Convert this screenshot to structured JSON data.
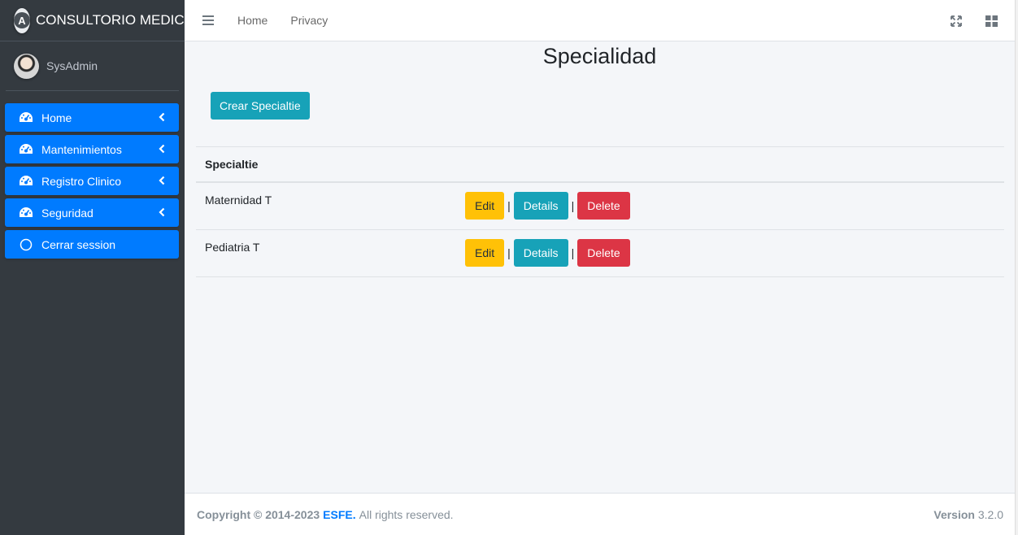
{
  "brand": {
    "name": "CONSULTORIO MEDICO",
    "logo_letter": "A"
  },
  "user": {
    "name": "SysAdmin"
  },
  "sidebar": {
    "items": [
      {
        "label": "Home",
        "icon": "tachometer-icon",
        "has_arrow": true
      },
      {
        "label": "Mantenimientos",
        "icon": "tachometer-icon",
        "has_arrow": true
      },
      {
        "label": "Registro Clinico",
        "icon": "tachometer-icon",
        "has_arrow": true
      },
      {
        "label": "Seguridad",
        "icon": "tachometer-icon",
        "has_arrow": true
      },
      {
        "label": "Cerrar session",
        "icon": "circle-icon",
        "has_arrow": false
      }
    ]
  },
  "header": {
    "nav": [
      {
        "label": "Home"
      },
      {
        "label": "Privacy"
      }
    ],
    "icons": [
      "fullscreen-icon",
      "grid-icon"
    ]
  },
  "main": {
    "title": "Specialidad",
    "create_label": "Crear Specialtie",
    "table": {
      "column_header": "Specialtie",
      "rows": [
        {
          "name": "Maternidad T"
        },
        {
          "name": "Pediatria T"
        }
      ],
      "actions": {
        "edit": "Edit",
        "details": "Details",
        "delete": "Delete",
        "separator": "|"
      }
    }
  },
  "footer": {
    "copyright": "Copyright © 2014-2023",
    "brand_link": "ESFE.",
    "rights": "All rights reserved.",
    "version_label": "Version",
    "version_value": "3.2.0"
  },
  "colors": {
    "sidebar_bg": "#343a40",
    "primary": "#007bff",
    "info": "#17a2b8",
    "warning": "#ffc107",
    "danger": "#dc3545",
    "content_bg": "#f4f6f9"
  }
}
